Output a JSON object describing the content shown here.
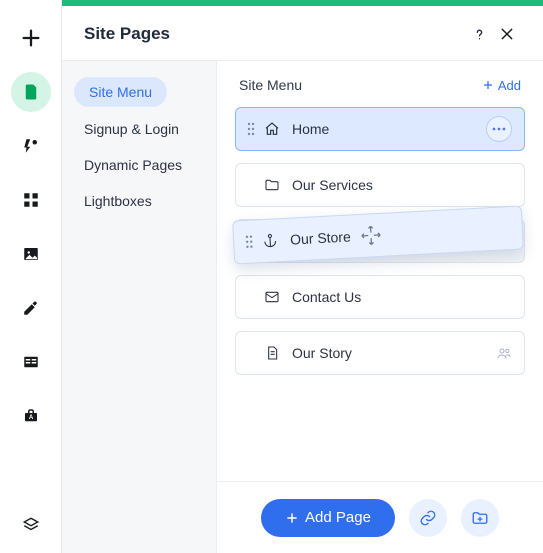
{
  "panel": {
    "title": "Site Pages"
  },
  "sidebar": {
    "items": [
      {
        "label": "Site Menu",
        "selected": true
      },
      {
        "label": "Signup & Login",
        "selected": false
      },
      {
        "label": "Dynamic Pages",
        "selected": false
      },
      {
        "label": "Lightboxes",
        "selected": false
      }
    ]
  },
  "main": {
    "heading": "Site Menu",
    "add_label": "Add",
    "pages": [
      {
        "label": "Home",
        "icon": "home",
        "active": true,
        "has_more": true
      },
      {
        "label": "Our Services",
        "icon": "folder"
      },
      {
        "label": "Our Store",
        "icon": "anchor",
        "dragging": true
      },
      {
        "label": "Contact Us",
        "icon": "mail"
      },
      {
        "label": "Our Story",
        "icon": "page",
        "has_members": true
      }
    ]
  },
  "footer": {
    "add_page_label": "Add Page"
  }
}
